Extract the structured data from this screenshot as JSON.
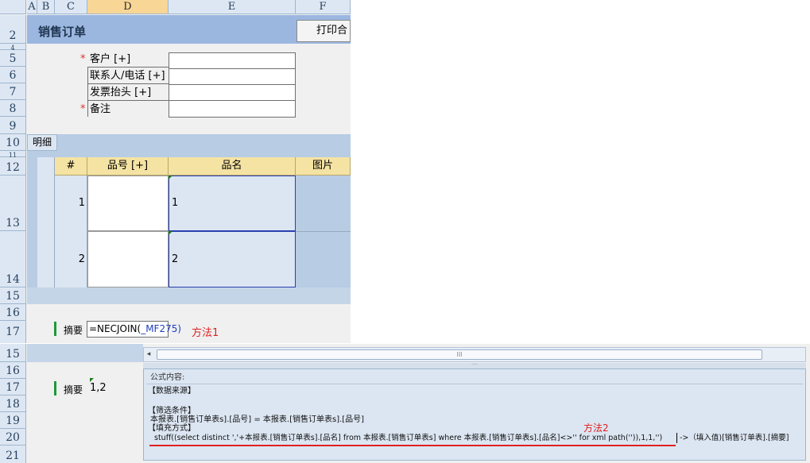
{
  "columns": [
    "A",
    "B",
    "C",
    "D",
    "E",
    "F"
  ],
  "top_rows": [
    "2",
    "4",
    "5",
    "6",
    "7",
    "8",
    "9",
    "10",
    "11",
    "12",
    "13",
    "14",
    "15",
    "16",
    "17"
  ],
  "bottom_rows": [
    "15",
    "16",
    "17",
    "18",
    "19",
    "20",
    "21"
  ],
  "header": {
    "title": "销售订单",
    "print_label": "打印合"
  },
  "form": {
    "required_mark": "*",
    "fields": [
      "客户 [+]",
      "联系人/电话 [+]",
      "发票抬头 [+]",
      "备注"
    ]
  },
  "detail": {
    "tab_label": "明细",
    "columns": [
      "#",
      "品号 [+]",
      "品名",
      "图片"
    ],
    "rows": [
      {
        "num": "1",
        "name": "1"
      },
      {
        "num": "2",
        "name": "2"
      }
    ]
  },
  "summary": {
    "label": "摘要",
    "formula_text": "=NECJOIN(",
    "formula_ref": "_MF275)",
    "method1": "方法1",
    "result_value": "1,2"
  },
  "editor": {
    "heading": "公式内容:",
    "source_header": "【数据来源】",
    "filter_header": "【筛选条件】",
    "filter_body": "本报表.[销售订单表s].[品号] = 本报表.[销售订单表s].[品号]",
    "fill_header": "【填充方式】",
    "fill_body": "stuff((select distinct ','+本报表.[销售订单表s].[品名] from 本报表.[销售订单表s] where 本报表.[销售订单表s].[品名]<>'' for xml path('')),1,1,'')",
    "fill_target": "->（填入值)[销售订单表].[摘要]",
    "method2": "方法2",
    "scroll_center": "III"
  },
  "colors": {
    "required": "#e03030",
    "method_annotation": "#e02020",
    "header_band": "#9bb7e0",
    "selected_column": "#f8d695"
  }
}
